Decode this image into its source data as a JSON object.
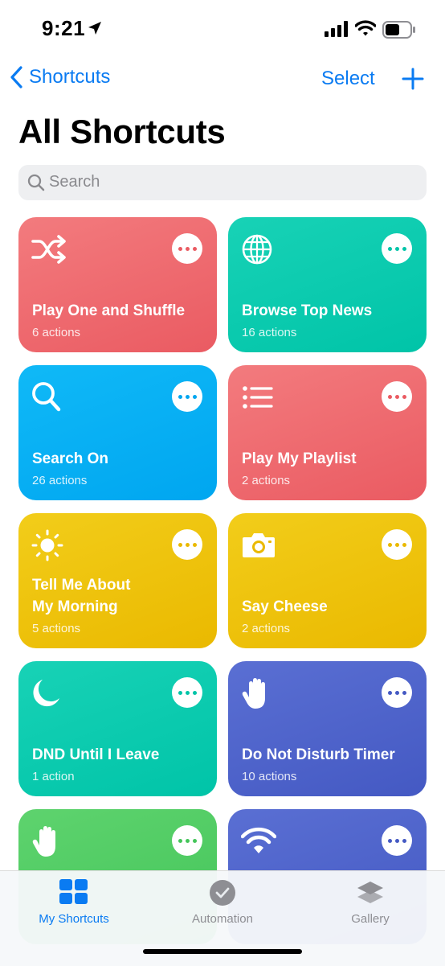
{
  "status_bar": {
    "time": "9:21"
  },
  "nav": {
    "back_label": "Shortcuts",
    "select_label": "Select"
  },
  "page": {
    "title": "All Shortcuts"
  },
  "search": {
    "placeholder": "Search"
  },
  "shortcuts": [
    {
      "title": "Play One and Shuffle",
      "subtitle": "6 actions",
      "color": "#ef6a6f",
      "icon": "shuffle-icon"
    },
    {
      "title": "Browse Top News",
      "subtitle": "16 actions",
      "color": "#0ccbb0",
      "icon": "globe-icon"
    },
    {
      "title": "Search On",
      "subtitle": "26 actions",
      "color": "#07b0f4",
      "icon": "magnifier-icon"
    },
    {
      "title": "Play My Playlist",
      "subtitle": "2 actions",
      "color": "#ef6a6f",
      "icon": "list-icon"
    },
    {
      "title": "Tell Me About My Morning",
      "subtitle": "5 actions",
      "color": "#eec30d",
      "icon": "sun-icon"
    },
    {
      "title": "Say Cheese",
      "subtitle": "2 actions",
      "color": "#eec30d",
      "icon": "camera-icon"
    },
    {
      "title": "DND Until I Leave",
      "subtitle": "1 action",
      "color": "#0ccbb0",
      "icon": "moon-icon"
    },
    {
      "title": "Do Not Disturb Timer",
      "subtitle": "10 actions",
      "color": "#4e64cb",
      "icon": "hand-icon"
    },
    {
      "title": "",
      "subtitle": "",
      "color": "#51cc64",
      "icon": "hand-icon"
    },
    {
      "title": "",
      "subtitle": "",
      "color": "#4e64cb",
      "icon": "wifi-icon"
    }
  ],
  "tabs": [
    {
      "label": "My Shortcuts",
      "icon": "grid-icon",
      "active": true,
      "color": "#0a7bf2"
    },
    {
      "label": "Automation",
      "icon": "clock-icon",
      "active": false,
      "color": "#8e8e93"
    },
    {
      "label": "Gallery",
      "icon": "layers-icon",
      "active": false,
      "color": "#8e8e93"
    }
  ]
}
